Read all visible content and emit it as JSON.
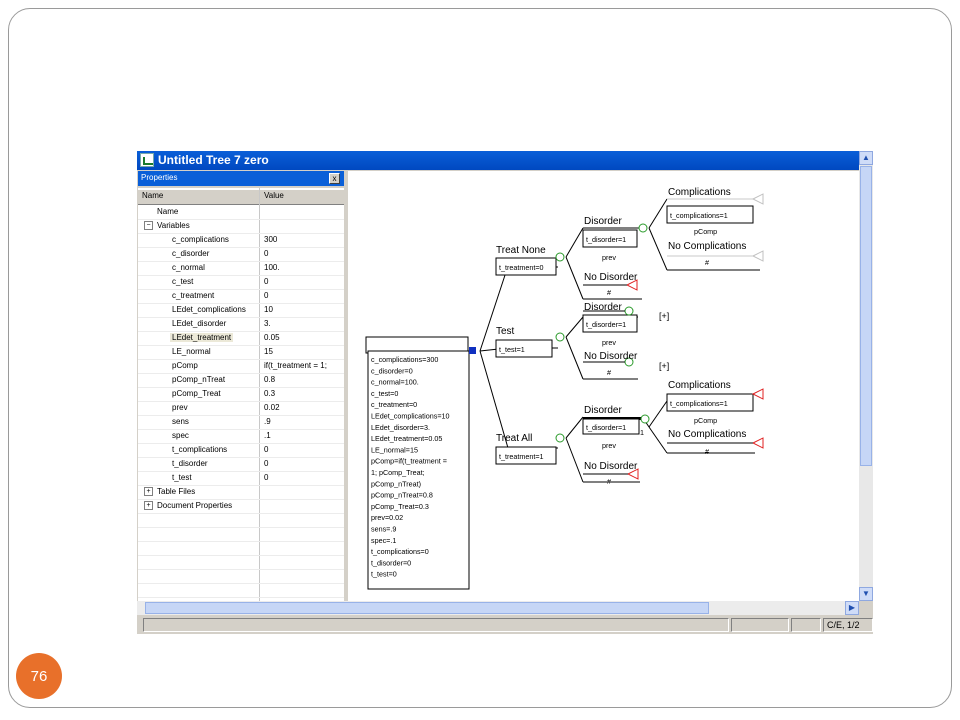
{
  "slide": {
    "page_number": "76"
  },
  "window": {
    "title": "Untitled Tree 7 zero"
  },
  "properties_panel": {
    "title": "Properties",
    "close_glyph": "x",
    "col_name": "Name",
    "col_value": "Value",
    "rows": [
      {
        "name": "Name",
        "value": ""
      },
      {
        "name": "Variables",
        "value": "",
        "toggle": "−"
      },
      {
        "name": "c_complications",
        "value": "300"
      },
      {
        "name": "c_disorder",
        "value": "0"
      },
      {
        "name": "c_normal",
        "value": "100."
      },
      {
        "name": "c_test",
        "value": "0"
      },
      {
        "name": "c_treatment",
        "value": "0"
      },
      {
        "name": "LEdet_complications",
        "value": "10"
      },
      {
        "name": "LEdet_disorder",
        "value": "3."
      },
      {
        "name": "LEdet_treatment",
        "value": "0.05"
      },
      {
        "name": "LE_normal",
        "value": "15"
      },
      {
        "name": "pComp",
        "value": "if(t_treatment = 1;"
      },
      {
        "name": "pComp_nTreat",
        "value": "0.8"
      },
      {
        "name": "pComp_Treat",
        "value": "0.3"
      },
      {
        "name": "prev",
        "value": "0.02"
      },
      {
        "name": "sens",
        "value": ".9"
      },
      {
        "name": "spec",
        "value": ".1"
      },
      {
        "name": "t_complications",
        "value": "0"
      },
      {
        "name": "t_disorder",
        "value": "0"
      },
      {
        "name": "t_test",
        "value": "0"
      },
      {
        "name": "Table Files",
        "value": "",
        "toggle": "+"
      },
      {
        "name": "Document Properties",
        "value": "",
        "toggle": "+"
      }
    ]
  },
  "tree": {
    "root_definitions": [
      "c_complications=300",
      "c_disorder=0",
      "c_normal=100.",
      "c_test=0",
      "c_treatment=0",
      "LEdet_complications=10",
      "LEdet_disorder=3.",
      "LEdet_treatment=0.05",
      "LE_normal=15",
      "pComp=if(t_treatment =",
      "  1; pComp_Treat;",
      "  pComp_nTreat)",
      "pComp_nTreat=0.8",
      "pComp_Treat=0.3",
      "prev=0.02",
      "sens=.9",
      "spec=.1",
      "t_complications=0",
      "t_disorder=0",
      "t_test=0"
    ],
    "treat_none": {
      "label": "Treat None",
      "def": "t_treatment=0",
      "disorder": {
        "label": "Disorder",
        "def": "t_disorder=1",
        "prob": "prev"
      },
      "complications": {
        "label": "Complications",
        "def": "t_complications=1",
        "prob": "pComp"
      },
      "no_complications": {
        "label": "No Complications",
        "prob": "#"
      },
      "no_disorder": {
        "label": "No Disorder",
        "prob": "#"
      }
    },
    "test": {
      "label": "Test",
      "def": "t_test=1",
      "disorder": {
        "label": "Disorder",
        "def": "t_disorder=1",
        "prob": "prev",
        "collapsed": "[+]"
      },
      "no_disorder": {
        "label": "No Disorder",
        "prob": "#",
        "collapsed": "[+]"
      }
    },
    "treat_all": {
      "label": "Treat All",
      "def": "t_treatment=1",
      "disorder": {
        "label": "Disorder",
        "def": "t_disorder=1",
        "prob": "prev",
        "marker": "1"
      },
      "complications": {
        "label": "Complications",
        "def": "t_complications=1",
        "prob": "pComp"
      },
      "no_complications": {
        "label": "No Complications",
        "prob": "#"
      },
      "no_disorder": {
        "label": "No Disorder",
        "prob": "#"
      }
    }
  },
  "status_bar": {
    "position": "C/E, 1/2"
  },
  "colors": {
    "title_bar": "#0a5fd8",
    "chance_node": "#2a9a2a",
    "terminal_red": "#e02020",
    "terminal_gray": "#b0b0b0",
    "decision_node": "#1030c0",
    "badge": "#e8702a"
  },
  "icons": {
    "scroll_up": "▲",
    "scroll_down": "▼",
    "scroll_left": "◀",
    "scroll_right": "▶"
  }
}
